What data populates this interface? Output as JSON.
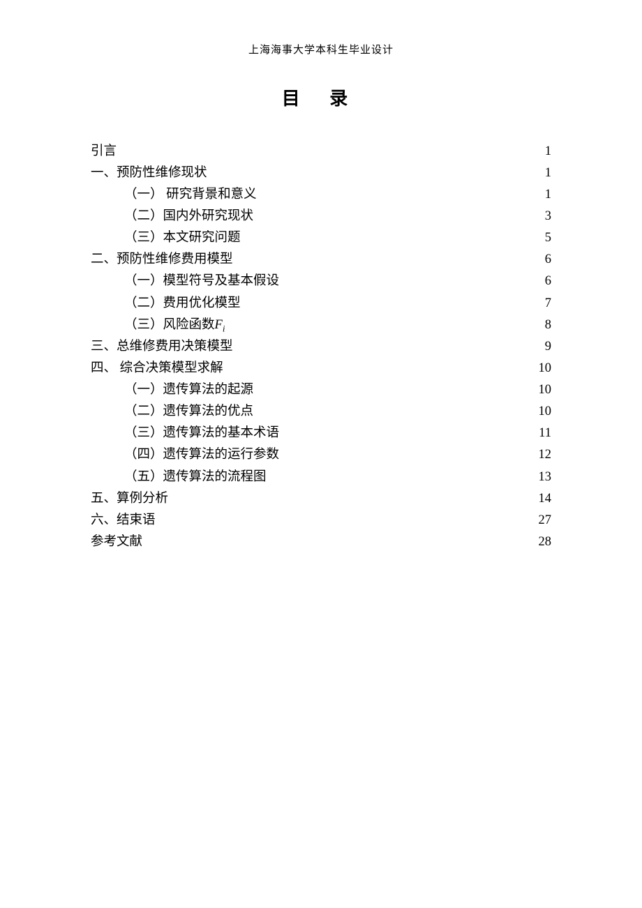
{
  "header": "上海海事大学本科生毕业设计",
  "title": "目  录",
  "toc": [
    {
      "level": 1,
      "label": "引言",
      "page": "1"
    },
    {
      "level": 1,
      "label": "一、预防性维修现状",
      "page": "1"
    },
    {
      "level": 2,
      "label": "（一） 研究背景和意义",
      "page": "1"
    },
    {
      "level": 2,
      "label": "（二）国内外研究现状",
      "page": "3"
    },
    {
      "level": 2,
      "label": "（三）本文研究问题",
      "page": "5"
    },
    {
      "level": 1,
      "label": "二、预防性维修费用模型",
      "page": "6"
    },
    {
      "level": 2,
      "label": "（一）模型符号及基本假设",
      "page": "6"
    },
    {
      "level": 2,
      "label": "（二）费用优化模型",
      "page": "7"
    },
    {
      "level": 2,
      "label": "（三）风险函数",
      "suffix_math": "F_i",
      "page": "8"
    },
    {
      "level": 1,
      "label": "三、总维修费用决策模型",
      "page": "9"
    },
    {
      "level": 1,
      "label": "四、 综合决策模型求解",
      "page": "10"
    },
    {
      "level": 2,
      "label": "（一）遗传算法的起源",
      "page": "10"
    },
    {
      "level": 2,
      "label": "（二）遗传算法的优点",
      "page": "10"
    },
    {
      "level": 2,
      "label": "（三）遗传算法的基本术语",
      "page": "11"
    },
    {
      "level": 2,
      "label": "（四）遗传算法的运行参数",
      "page": "12"
    },
    {
      "level": 2,
      "label": "（五）遗传算法的流程图",
      "page": "13"
    },
    {
      "level": 1,
      "label": "五、算例分析",
      "page": "14"
    },
    {
      "level": 1,
      "label": "六、结束语",
      "page": "27"
    },
    {
      "level": 1,
      "label": "参考文献",
      "page": "28"
    }
  ]
}
